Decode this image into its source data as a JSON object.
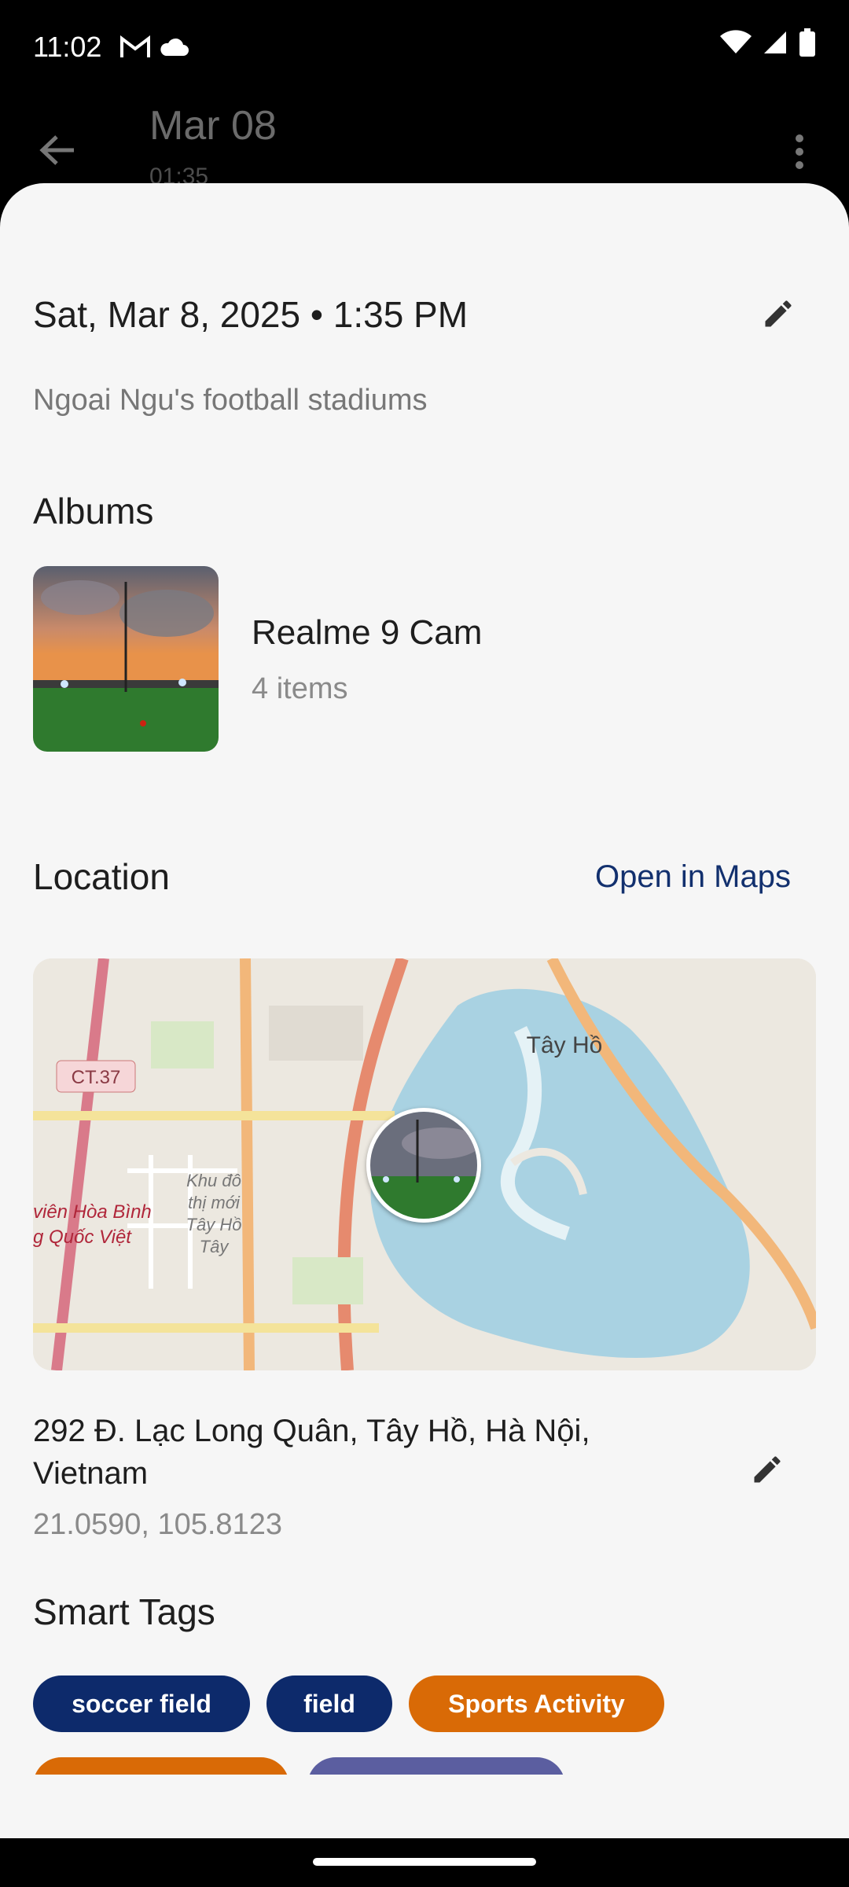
{
  "status_bar": {
    "time": "11:02"
  },
  "app_bar": {
    "title": "Mar 08",
    "subtitle": "01:35"
  },
  "details": {
    "date_time": "Sat, Mar 8, 2025 • 1:35 PM",
    "caption": "Ngoai Ngu's football stadiums"
  },
  "albums": {
    "title": "Albums",
    "items": [
      {
        "name": "Realme 9 Cam",
        "count": "4 items"
      }
    ]
  },
  "location": {
    "title": "Location",
    "open_label": "Open in Maps",
    "map_labels": {
      "district": "Tây Hồ",
      "road": "CT.37",
      "area_1": "Khu đô",
      "area_2": "thị mới",
      "area_3": "Tây Hồ",
      "area_4": "Tây",
      "poi_1": "viên Hòa Bình",
      "poi_2": "g Quốc Việt"
    },
    "address_line1": "292 Đ. Lạc Long Quân, Tây Hồ, Hà Nội,",
    "address_line2": "Vietnam",
    "coordinates": "21.0590, 105.8123"
  },
  "smart_tags": {
    "title": "Smart Tags",
    "items": [
      {
        "label": "soccer field",
        "color": "#0d2a6b"
      },
      {
        "label": "field",
        "color": "#0d2a6b"
      },
      {
        "label": "Sports Activity",
        "color": "#d96a06"
      }
    ]
  },
  "colors": {
    "sheet": "#f6f6f6",
    "accent_blue": "#0d2a6b",
    "accent_orange": "#d96a06",
    "accent_purple": "#5b5ea0"
  }
}
